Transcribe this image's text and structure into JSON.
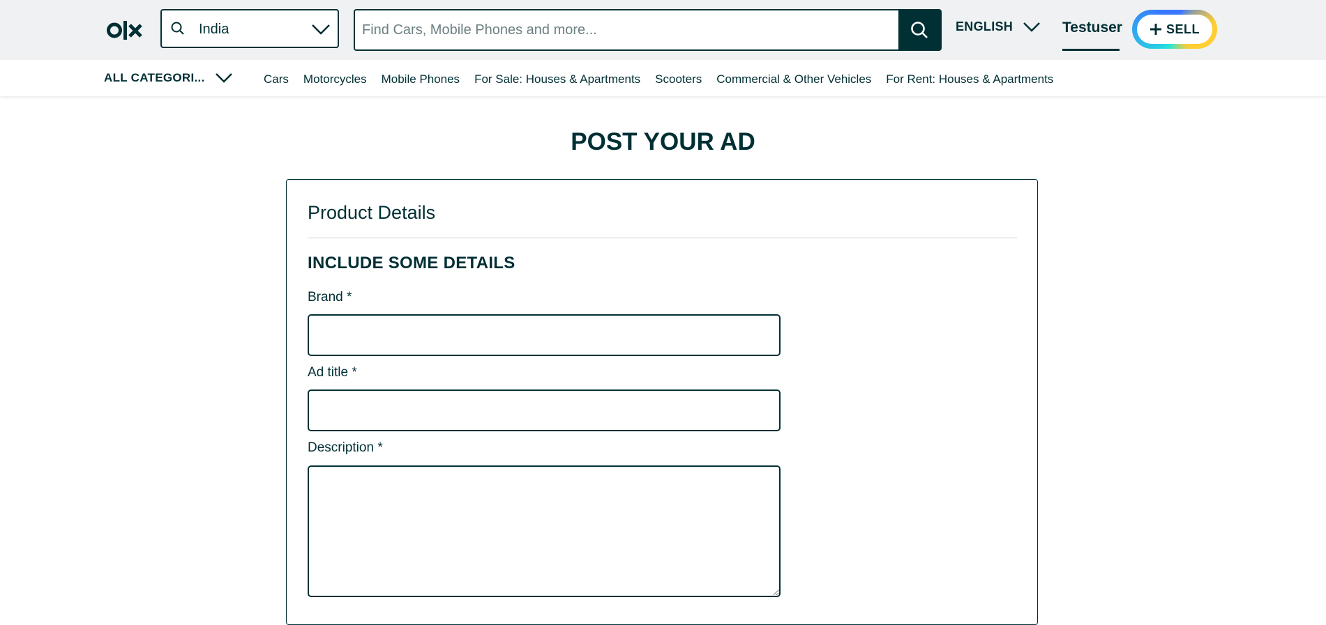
{
  "header": {
    "logo_text": "OLX",
    "location": "India",
    "search_placeholder": "Find Cars, Mobile Phones and more...",
    "language": "ENGLISH",
    "username": "Testuser",
    "sell_label": "SELL"
  },
  "categories": {
    "all_label": "ALL CATEGORI...",
    "items": [
      "Cars",
      "Motorcycles",
      "Mobile Phones",
      "For Sale: Houses & Apartments",
      "Scooters",
      "Commercial & Other Vehicles",
      "For Rent: Houses & Apartments"
    ]
  },
  "main": {
    "page_title": "POST YOUR AD",
    "card_title": "Product Details",
    "section_title": "INCLUDE SOME DETAILS",
    "fields": {
      "brand_label": "Brand *",
      "brand_value": "",
      "ad_title_label": "Ad title *",
      "ad_title_value": "",
      "description_label": "Description *",
      "description_value": ""
    }
  },
  "colors": {
    "primary": "#002f34",
    "header_bg": "#eff1f3",
    "sell_ring": [
      "#23e5db",
      "#3a77ff",
      "#ffce32"
    ]
  },
  "icons": [
    "olx-logo",
    "search-icon",
    "chevron-down-icon",
    "plus-icon"
  ]
}
